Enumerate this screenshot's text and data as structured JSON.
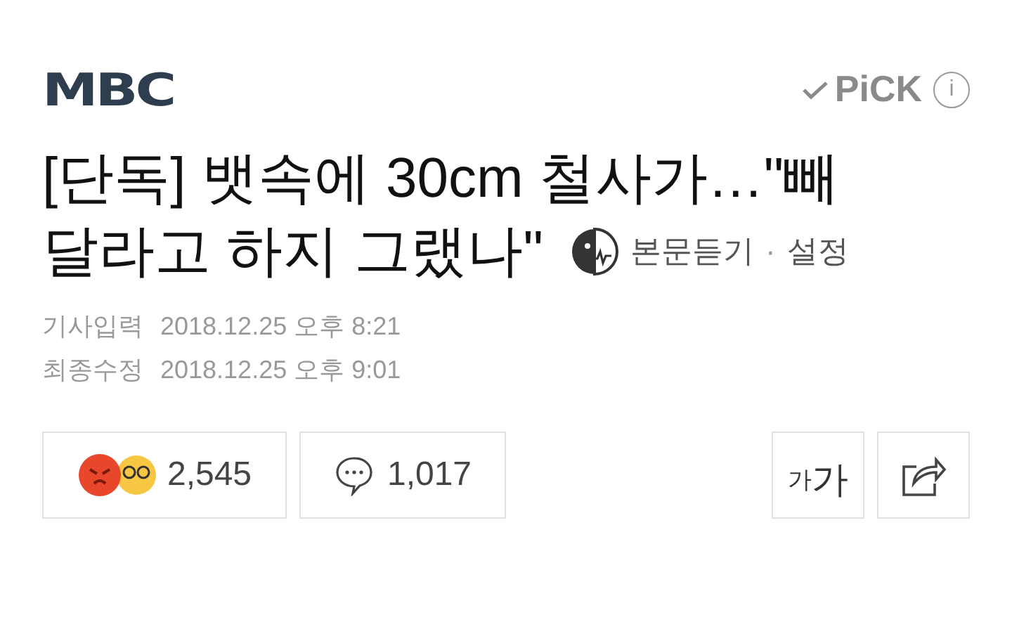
{
  "header": {
    "logo": "MBC",
    "pick": "PiCK",
    "info": "i"
  },
  "headline_lines": [
    "[단독] 뱃속에 30cm 철사가…\"빼",
    "달라고 하지 그랬나\""
  ],
  "tts": {
    "listen": "본문듣기",
    "separator": "·",
    "settings": "설정"
  },
  "dates": [
    {
      "label": "기사입력",
      "value": "2018.12.25 오후 8:21"
    },
    {
      "label": "최종수정",
      "value": "2018.12.25 오후 9:01"
    }
  ],
  "reactions": {
    "count": "2,545"
  },
  "comments": {
    "count": "1,017"
  },
  "font_size_button": {
    "small": "가",
    "large": "가"
  }
}
